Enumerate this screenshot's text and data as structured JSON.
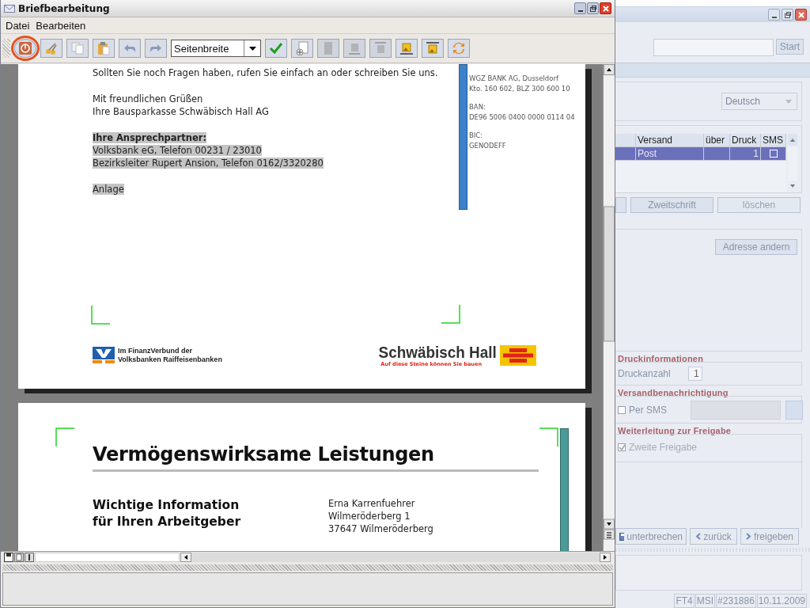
{
  "editor": {
    "title": "Briefbearbeitung",
    "menu": [
      {
        "label": "Datei"
      },
      {
        "label": "Bearbeiten"
      }
    ],
    "toolbar": [
      {
        "kind": "power",
        "disabled": false,
        "circled": true
      },
      {
        "kind": "cut",
        "disabled": false,
        "circled": false
      },
      {
        "kind": "copy",
        "disabled": false,
        "circled": false
      },
      {
        "kind": "paste",
        "disabled": false,
        "circled": false
      },
      {
        "kind": "undo",
        "disabled": false,
        "circled": false
      },
      {
        "kind": "redo",
        "disabled": false,
        "circled": false
      },
      {
        "kind": "zoom",
        "value": "Seitenbreite",
        "disabled": false,
        "circled": false
      },
      {
        "kind": "check",
        "disabled": false,
        "circled": false
      },
      {
        "kind": "add-page",
        "disabled": false,
        "circled": false
      },
      {
        "kind": "page",
        "disabled": true,
        "circled": false
      },
      {
        "kind": "page-bottom",
        "disabled": true,
        "circled": false
      },
      {
        "kind": "page-top",
        "disabled": true,
        "circled": false
      },
      {
        "kind": "image-bottom",
        "disabled": false,
        "circled": false
      },
      {
        "kind": "image-top",
        "disabled": false,
        "circled": false
      },
      {
        "kind": "refresh",
        "disabled": false,
        "circled": false
      }
    ],
    "letter_page": {
      "blocks": [
        {
          "lines": [
            {
              "text": "Sollten Sie noch Fragen haben, rufen Sie einfach an oder schreiben Sie uns.",
              "bold": false,
              "highlighted": false
            }
          ]
        },
        {
          "lines": [
            {
              "text": "Mit freundlichen Grüßen",
              "bold": false,
              "highlighted": false
            },
            {
              "text": "Ihre Bausparkasse Schwäbisch Hall AG",
              "bold": false,
              "highlighted": false
            }
          ]
        },
        {
          "lines": [
            {
              "text": "Ihre Ansprechpartner:",
              "bold": true,
              "highlighted": true
            },
            {
              "text": "Volksbank eG, Telefon 00231 / 23010",
              "bold": false,
              "highlighted": true
            },
            {
              "text": "Bezirksleiter Rupert Ansion, Telefon 0162/3320280",
              "bold": false,
              "highlighted": true
            }
          ]
        },
        {
          "lines": [
            {
              "text": "Anlage",
              "bold": false,
              "highlighted": true
            }
          ]
        }
      ],
      "bank_info": [
        [
          "WGZ BANK AG, Dusseldorf",
          "Kto. 160 602, BLZ 300 600 10"
        ],
        [
          "BAN:",
          "DE96 5006 0400 0000 0114 04"
        ],
        [
          "BIC:",
          "GENODEFF"
        ]
      ],
      "partner_logo": [
        "Im FinanzVerbund der",
        "Volksbanken Raiffeisenbanken"
      ],
      "brand": {
        "name": "Schwäbisch Hall",
        "tagline": "Auf diese Steine können Sie bauen"
      }
    },
    "info_page": {
      "title": "Vermögenswirksame Leistungen",
      "subtitle": [
        "Wichtige Information",
        "für Ihren Arbeitgeber"
      ],
      "address": [
        "Erna Karrenfuehrer",
        "Wilmeröderberg 1",
        "37647 Wilmeröderberg"
      ]
    }
  },
  "main_window": {
    "search_button": "Start",
    "language": {
      "value": "Deutsch",
      "disabled": true
    },
    "dispatch_table": {
      "columns": [
        "Versand",
        "über",
        "Druck",
        "SMS"
      ],
      "rows": [
        {
          "versand": "Post",
          "druck": "1",
          "sms": false,
          "selected": true
        }
      ]
    },
    "copy_buttons": [
      {
        "label": "Zweitschrift",
        "disabled": false
      },
      {
        "label": "löschen",
        "disabled": true
      }
    ],
    "address_button": "Adresse andern",
    "print_info": {
      "title": "Druckinformationen",
      "label": "Druckanzahl",
      "value": "1"
    },
    "notification": {
      "title": "Versandbenachrichtigung",
      "label": "Per SMS",
      "checked": false,
      "disabled": false
    },
    "forwarding": {
      "title": "Weiterleitung zur Freigabe",
      "label": "Zweite Freigabe",
      "checked": true,
      "disabled": true
    },
    "nav_buttons": [
      {
        "kind": "save",
        "label": "unterbrechen"
      },
      {
        "kind": "back",
        "label": "zurück"
      },
      {
        "kind": "forward",
        "label": "freigeben"
      }
    ],
    "status": [
      "FT4",
      "MSI",
      "#231886",
      "10.11.2009"
    ]
  }
}
